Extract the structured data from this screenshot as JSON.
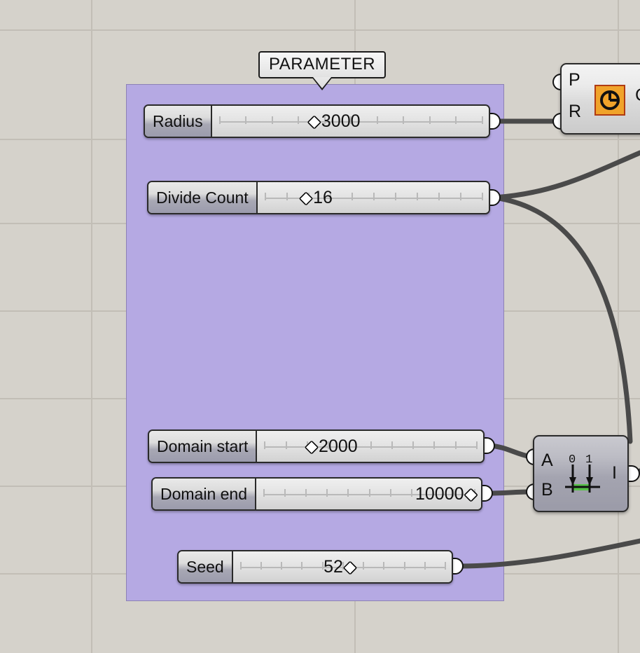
{
  "canvas": {
    "background_color": "#d5d2cb",
    "grid_color": "#c2beb6"
  },
  "group": {
    "label": "PARAMETER",
    "fill_color": "#b5a9e3",
    "border_color": "#8d82b5"
  },
  "sliders": [
    {
      "name": "radius",
      "label": "Radius",
      "value": "3000",
      "gem": "◆",
      "gem_side": "left",
      "handle_pct": 37,
      "ticks": 11
    },
    {
      "name": "divide-count",
      "label": "Divide Count",
      "value": "16",
      "gem": "◆",
      "gem_side": "left",
      "handle_pct": 21,
      "ticks": 11
    },
    {
      "name": "domain-start",
      "label": "Domain start",
      "value": "2000",
      "gem": "◆",
      "gem_side": "left",
      "handle_pct": 24,
      "ticks": 11
    },
    {
      "name": "domain-end",
      "label": "Domain end",
      "value": "10000",
      "gem": "◆",
      "gem_side": "right",
      "handle_pct": 95,
      "ticks": 11
    },
    {
      "name": "seed",
      "label": "Seed",
      "value": "52",
      "gem": "◆",
      "gem_side": "right",
      "handle_pct": 53,
      "ticks": 11
    }
  ],
  "components": [
    {
      "name": "circle",
      "icon": "circle-clock-icon",
      "icon_color": "#f0a32a",
      "icon_border_color": "#b03b12",
      "inputs": [
        "P",
        "R"
      ],
      "outputs": [
        "C"
      ]
    },
    {
      "name": "construct-domain",
      "icon": "domain-interval-icon",
      "icon_accent_color": "#56c147",
      "icon_labels": [
        "0",
        "1"
      ],
      "inputs": [
        "A",
        "B"
      ],
      "outputs": [
        "I"
      ]
    }
  ],
  "wires": {
    "color": "#4a4a4a",
    "count": 6
  }
}
